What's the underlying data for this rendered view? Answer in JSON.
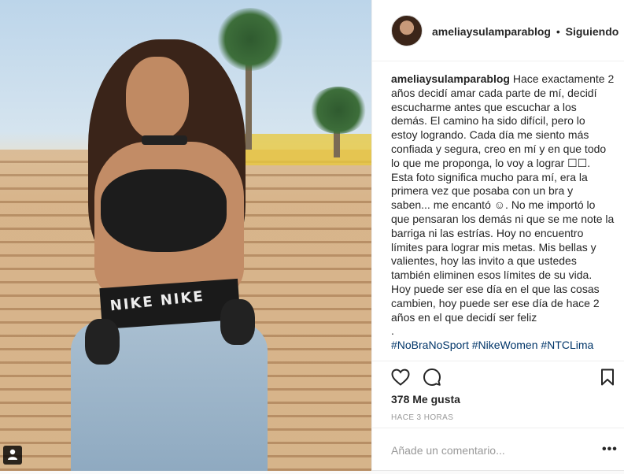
{
  "post": {
    "username": "ameliaysulamparablog",
    "separator": "•",
    "follow_status": "Siguiendo",
    "caption_text": "Hace exactamente 2 años decidí amar cada parte de mí, decidí escucharme antes que escuchar a los demás. El camino ha sido difícil, pero lo estoy logrando. Cada día me siento más confiada y segura, creo en mí y en que todo lo que me proponga, lo voy a lograr ☐☐. Esta foto significa mucho para mí, era la primera vez que posaba con un bra y saben... me encantó ☺. No me importó lo que pensaran los demás ni que se me note la barriga ni las estrías. Hoy no encuentro límites para lograr mis metas. Mis bellas y valientes, hoy las invito a que ustedes también eliminen esos límites de su vida. Hoy puede ser ese día en el que las cosas cambien, hoy puede ser ese día de hace 2 años en el que decidí ser feliz",
    "caption_dot": ".",
    "hashtags": "#NoBraNoSport #NikeWomen #NTCLima",
    "likes": "378 Me gusta",
    "timestamp": "HACE 3 HORAS",
    "comment_placeholder": "Añade un comentario...",
    "more_label": "•••",
    "photo_waistband_text": "NIKE NIKE"
  },
  "icons": {
    "like": "heart-icon",
    "comment": "comment-icon",
    "save": "bookmark-icon",
    "tag": "user-tag-icon"
  },
  "colors": {
    "text": "#262626",
    "muted": "#999999",
    "hashtag": "#003569",
    "border": "#efefef"
  }
}
